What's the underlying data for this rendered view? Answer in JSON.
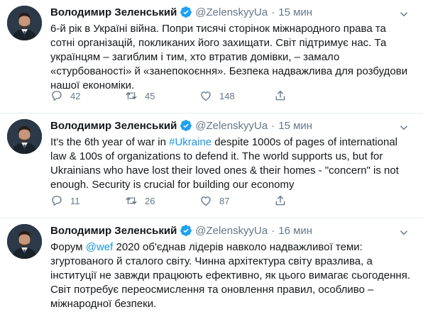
{
  "tweets": [
    {
      "author": "Володимир Зеленський",
      "handle": "@ZelenskyyUa",
      "time": "15 мин",
      "text": "6-й рік в Україні війна. Попри тисячі сторінок міжнародного права та\nсотні організацій, покликаних його захищати. Світ підтримує нас. Та\nукраїнцям – загиблим і тим, хто втратив домівки, – замало\n«стурбованості» й «занепокоєння». Безпека надважлива для розбудови\nнашої економіки.",
      "replies": "42",
      "retweets": "45",
      "likes": "148"
    },
    {
      "author": "Володимир Зеленський",
      "handle": "@ZelenskyyUa",
      "time": "15 мин",
      "text_before": "It's the 6th year of war in ",
      "hashtag": "#Ukraine",
      "text_after": " despite 1000s of pages of international\nlaw & 100s of organizations to defend it. The world supports us, but for\nUkrainians who have lost their loved ones & their homes - \"concern\" is not\nenough. Security is crucial for building our economy",
      "replies": "11",
      "retweets": "26",
      "likes": "87"
    },
    {
      "author": "Володимир Зеленський",
      "handle": "@ZelenskyyUa",
      "time": "16 мин",
      "text_before": "Форум ",
      "mention": "@wef",
      "text_after": " 2020 об'єднав лідерів навколо надважливої теми:\nзгуртованого й сталого світу. Чинна архітектура світу вразлива, а\nінституції не завжди працюють ефективно, як цього вимагає сьогодення.\nСвіт потребує переосмислення та оновлення правил, особливо –\nміжнародної безпеки."
    }
  ],
  "colors": {
    "text": "#14171a",
    "muted": "#657786",
    "link": "#1b95e0",
    "verified": "#1da1f2",
    "divider": "#e6ecf0"
  },
  "icons": [
    "avatar",
    "verified-badge-icon",
    "chevron-down-icon",
    "reply-icon",
    "retweet-icon",
    "like-icon",
    "share-icon"
  ]
}
